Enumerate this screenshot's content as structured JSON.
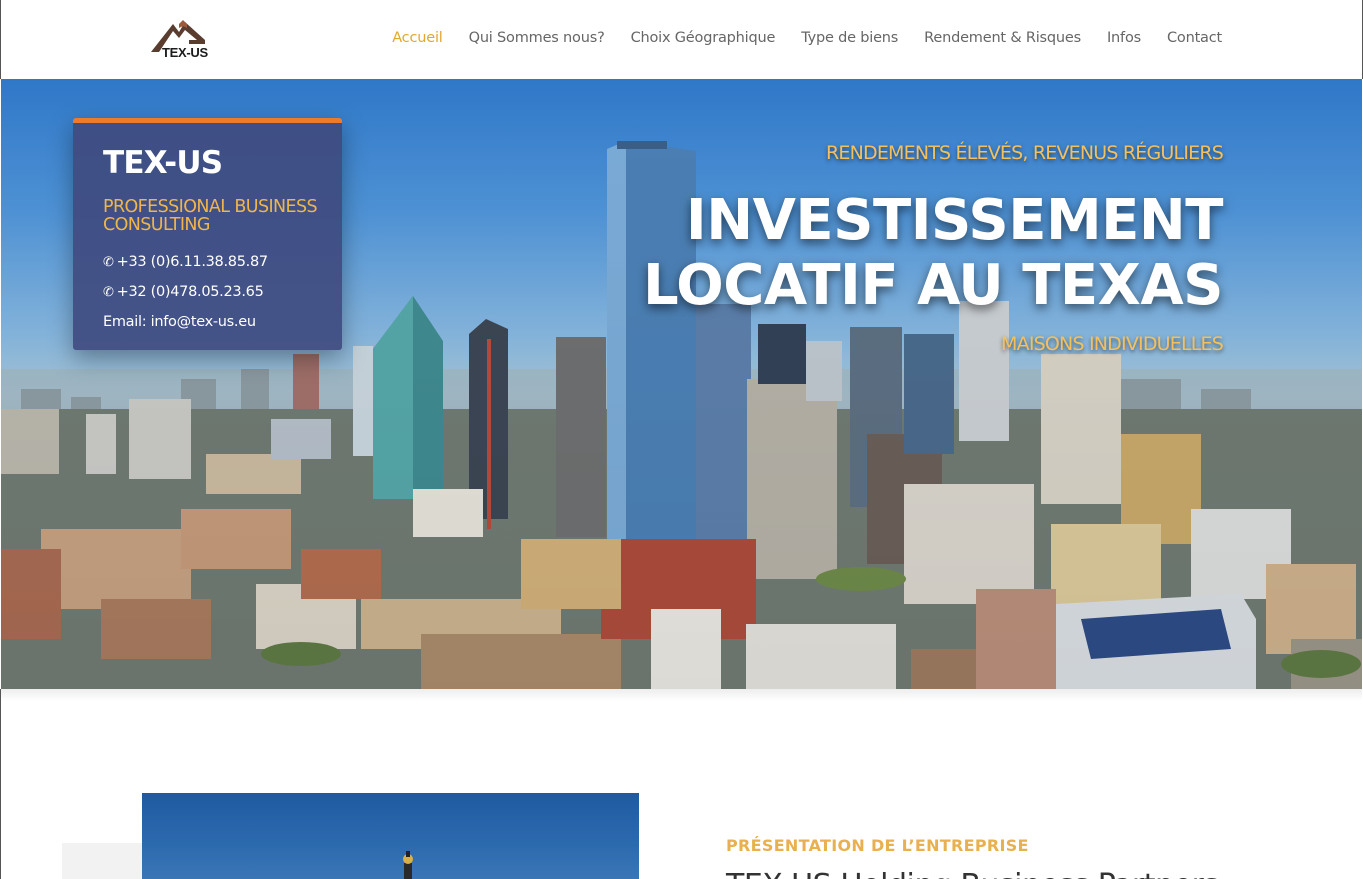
{
  "header": {
    "logo_text": "TEX-US",
    "nav": [
      {
        "label": "Accueil",
        "active": true
      },
      {
        "label": "Qui Sommes nous?",
        "active": false
      },
      {
        "label": "Choix Géographique",
        "active": false
      },
      {
        "label": "Type de biens",
        "active": false
      },
      {
        "label": "Rendement & Risques",
        "active": false
      },
      {
        "label": "Infos",
        "active": false
      },
      {
        "label": "Contact",
        "active": false
      }
    ]
  },
  "hero": {
    "card": {
      "title": "TEX-US",
      "subtitle": "PROFESSIONAL BUSINESS CONSULTING",
      "phone1": "+33 (0)6.11.38.85.87",
      "phone2": "+32 (0)478.05.23.65",
      "email": "Email: info@tex-us.eu"
    },
    "kicker": "RENDEMENTS ÉLEVÉS, REVENUS RÉGULIERS",
    "title_line1": "INVESTISSEMENT",
    "title_line2": "LOCATIF AU TEXAS",
    "tagline": "MAISONS INDIVIDUELLES"
  },
  "section": {
    "label": "PRÉSENTATION DE L’ENTREPRISE",
    "heading": "TEX-US Holding Business Partners"
  },
  "colors": {
    "accent": "#e2a72e",
    "card_bg": "#3f4b80",
    "card_border": "#ee7b2a",
    "gold_text": "#f4c05e"
  },
  "icons": {
    "phone": "phone-icon",
    "logo": "house-roof-logo"
  }
}
